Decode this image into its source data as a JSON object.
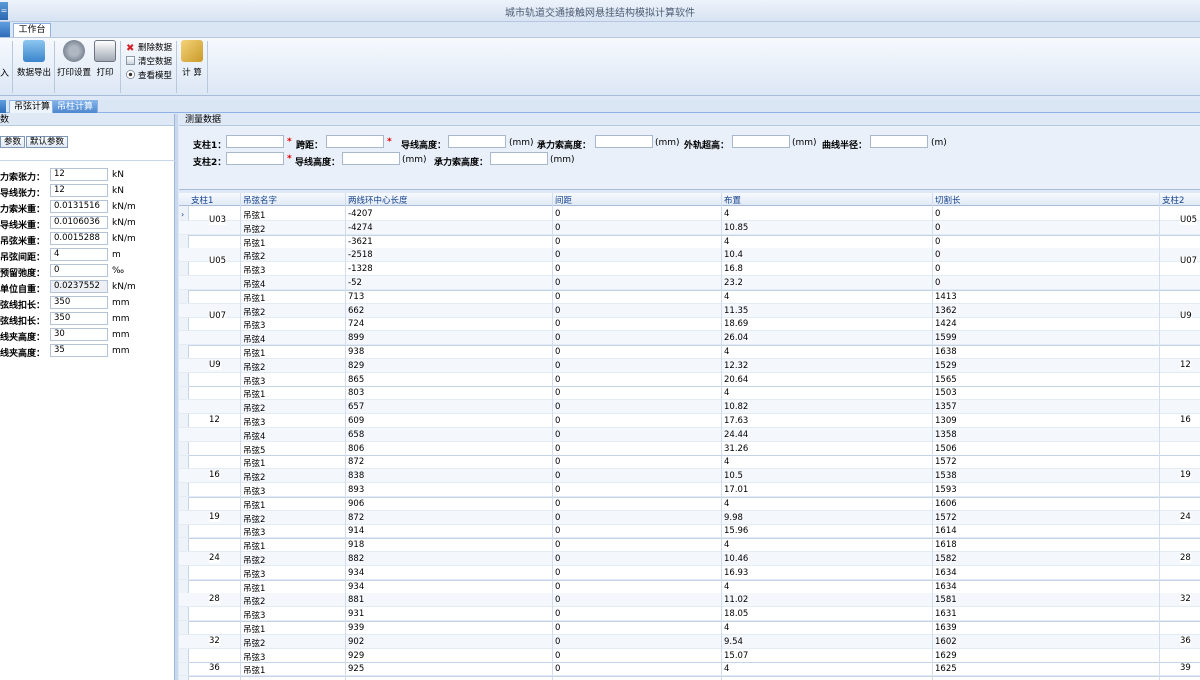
{
  "window": {
    "title": "城市轨道交通接触网悬挂结构模拟计算软件",
    "app_icon": "="
  },
  "ribbon_tab": "工作台",
  "ribbon": {
    "input_partial": "入",
    "export_label": "数据导出",
    "print_settings_label": "打印设置",
    "print_label": "打印",
    "delete_label": "删除数据",
    "clear_label": "清空数据",
    "view_model_label": "查看模型",
    "calc_label": "计 算"
  },
  "subtabs": [
    "吊弦计算",
    "吊柱计算"
  ],
  "left_panel": {
    "header": "数",
    "btn_params": "参数",
    "btn_default": "默认参数",
    "params": [
      {
        "label": "力索张力：",
        "value": "12",
        "unit": "kN",
        "readonly": false
      },
      {
        "label": "导线张力：",
        "value": "12",
        "unit": "kN",
        "readonly": false
      },
      {
        "label": "力索米重：",
        "value": "0.0131516",
        "unit": "kN/m",
        "readonly": false
      },
      {
        "label": "导线米重：",
        "value": "0.0106036",
        "unit": "kN/m",
        "readonly": false
      },
      {
        "label": "吊弦米重：",
        "value": "0.0015288",
        "unit": "kN/m",
        "readonly": false
      },
      {
        "label": "吊弦间距：",
        "value": "4",
        "unit": "m",
        "readonly": false
      },
      {
        "label": "预留弛度：",
        "value": "0",
        "unit": "‰",
        "readonly": false
      },
      {
        "label": "单位自重：",
        "value": "0.0237552",
        "unit": "kN/m",
        "readonly": true
      },
      {
        "label": "弦线扣长：",
        "value": "350",
        "unit": "mm",
        "readonly": false
      },
      {
        "label": "弦线扣长：",
        "value": "350",
        "unit": "mm",
        "readonly": false
      },
      {
        "label": "线夹高度：",
        "value": "30",
        "unit": "mm",
        "readonly": false
      },
      {
        "label": "线夹高度：",
        "value": "35",
        "unit": "mm",
        "readonly": false
      }
    ]
  },
  "measure": {
    "header": "测量数据",
    "pillar1": "支柱1：",
    "span": "跨距：",
    "wire_height1": "导线高度：",
    "messenger_height1": "承力索高度：",
    "outer_rail": "外轨超高：",
    "curve_radius": "曲线半径：",
    "pillar2": "支柱2：",
    "wire_height2": "导线高度：",
    "messenger_height2": "承力索高度：",
    "req": "*",
    "mm": "(mm)",
    "m": "(m)"
  },
  "grid": {
    "columns": [
      "支柱1",
      "吊弦名字",
      "两线环中心长度",
      "间距",
      "布置",
      "切割长",
      "支柱2"
    ],
    "groups": [
      {
        "p1": "U03",
        "p2": "U05",
        "rows": [
          [
            "吊弦1",
            "-4207",
            "0",
            "4",
            "0"
          ],
          [
            "吊弦2",
            "-4274",
            "0",
            "10.85",
            "0"
          ]
        ]
      },
      {
        "p1": "U05",
        "p2": "U07",
        "rows": [
          [
            "吊弦1",
            "-3621",
            "0",
            "4",
            "0"
          ],
          [
            "吊弦2",
            "-2518",
            "0",
            "10.4",
            "0"
          ],
          [
            "吊弦3",
            "-1328",
            "0",
            "16.8",
            "0"
          ],
          [
            "吊弦4",
            "-52",
            "0",
            "23.2",
            "0"
          ]
        ]
      },
      {
        "p1": "U07",
        "p2": "U9",
        "rows": [
          [
            "吊弦1",
            "713",
            "0",
            "4",
            "1413"
          ],
          [
            "吊弦2",
            "662",
            "0",
            "11.35",
            "1362"
          ],
          [
            "吊弦3",
            "724",
            "0",
            "18.69",
            "1424"
          ],
          [
            "吊弦4",
            "899",
            "0",
            "26.04",
            "1599"
          ]
        ]
      },
      {
        "p1": "U9",
        "p2": "12",
        "rows": [
          [
            "吊弦1",
            "938",
            "0",
            "4",
            "1638"
          ],
          [
            "吊弦2",
            "829",
            "0",
            "12.32",
            "1529"
          ],
          [
            "吊弦3",
            "865",
            "0",
            "20.64",
            "1565"
          ]
        ]
      },
      {
        "p1": "12",
        "p2": "16",
        "rows": [
          [
            "吊弦1",
            "803",
            "0",
            "4",
            "1503"
          ],
          [
            "吊弦2",
            "657",
            "0",
            "10.82",
            "1357"
          ],
          [
            "吊弦3",
            "609",
            "0",
            "17.63",
            "1309"
          ],
          [
            "吊弦4",
            "658",
            "0",
            "24.44",
            "1358"
          ],
          [
            "吊弦5",
            "806",
            "0",
            "31.26",
            "1506"
          ]
        ]
      },
      {
        "p1": "16",
        "p2": "19",
        "rows": [
          [
            "吊弦1",
            "872",
            "0",
            "4",
            "1572"
          ],
          [
            "吊弦2",
            "838",
            "0",
            "10.5",
            "1538"
          ],
          [
            "吊弦3",
            "893",
            "0",
            "17.01",
            "1593"
          ]
        ]
      },
      {
        "p1": "19",
        "p2": "24",
        "rows": [
          [
            "吊弦1",
            "906",
            "0",
            "4",
            "1606"
          ],
          [
            "吊弦2",
            "872",
            "0",
            "9.98",
            "1572"
          ],
          [
            "吊弦3",
            "914",
            "0",
            "15.96",
            "1614"
          ]
        ]
      },
      {
        "p1": "24",
        "p2": "28",
        "rows": [
          [
            "吊弦1",
            "918",
            "0",
            "4",
            "1618"
          ],
          [
            "吊弦2",
            "882",
            "0",
            "10.46",
            "1582"
          ],
          [
            "吊弦3",
            "934",
            "0",
            "16.93",
            "1634"
          ]
        ]
      },
      {
        "p1": "28",
        "p2": "32",
        "rows": [
          [
            "吊弦1",
            "934",
            "0",
            "4",
            "1634"
          ],
          [
            "吊弦2",
            "881",
            "0",
            "11.02",
            "1581"
          ],
          [
            "吊弦3",
            "931",
            "0",
            "18.05",
            "1631"
          ]
        ]
      },
      {
        "p1": "32",
        "p2": "36",
        "rows": [
          [
            "吊弦1",
            "939",
            "0",
            "4",
            "1639"
          ],
          [
            "吊弦2",
            "902",
            "0",
            "9.54",
            "1602"
          ],
          [
            "吊弦3",
            "929",
            "0",
            "15.07",
            "1629"
          ]
        ]
      },
      {
        "p1": "36",
        "p2": "39",
        "rows": [
          [
            "吊弦1",
            "925",
            "0",
            "4",
            "1625"
          ]
        ]
      }
    ]
  }
}
